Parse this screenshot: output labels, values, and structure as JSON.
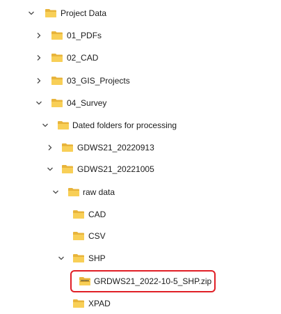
{
  "tree": {
    "items": [
      {
        "label": "Project Data",
        "expanded": true,
        "icon": "folder-icon"
      },
      {
        "label": "01_PDFs",
        "expanded": false,
        "icon": "folder-icon"
      },
      {
        "label": "02_CAD",
        "expanded": false,
        "icon": "folder-icon"
      },
      {
        "label": "03_GIS_Projects",
        "expanded": false,
        "icon": "folder-icon"
      },
      {
        "label": "04_Survey",
        "expanded": true,
        "icon": "folder-icon"
      },
      {
        "label": "Dated folders for processing",
        "expanded": true,
        "icon": "folder-icon"
      },
      {
        "label": "GDWS21_20220913",
        "expanded": false,
        "icon": "folder-icon"
      },
      {
        "label": "GDWS21_20221005",
        "expanded": true,
        "icon": "folder-icon"
      },
      {
        "label": "raw data",
        "expanded": true,
        "icon": "folder-icon"
      },
      {
        "label": "CAD",
        "icon": "folder-icon"
      },
      {
        "label": "CSV",
        "icon": "folder-icon"
      },
      {
        "label": "SHP",
        "expanded": true,
        "icon": "folder-icon"
      },
      {
        "label": "GRDWS21_2022-10-5_SHP.zip",
        "icon": "zip-folder-icon",
        "highlighted": true
      },
      {
        "label": "XPAD",
        "icon": "folder-icon"
      }
    ]
  },
  "colors": {
    "folder_back": "#e8b43b",
    "folder_front": "#f8cf57",
    "highlight_border": "#e01e25",
    "chevron": "#4a4a4a"
  }
}
